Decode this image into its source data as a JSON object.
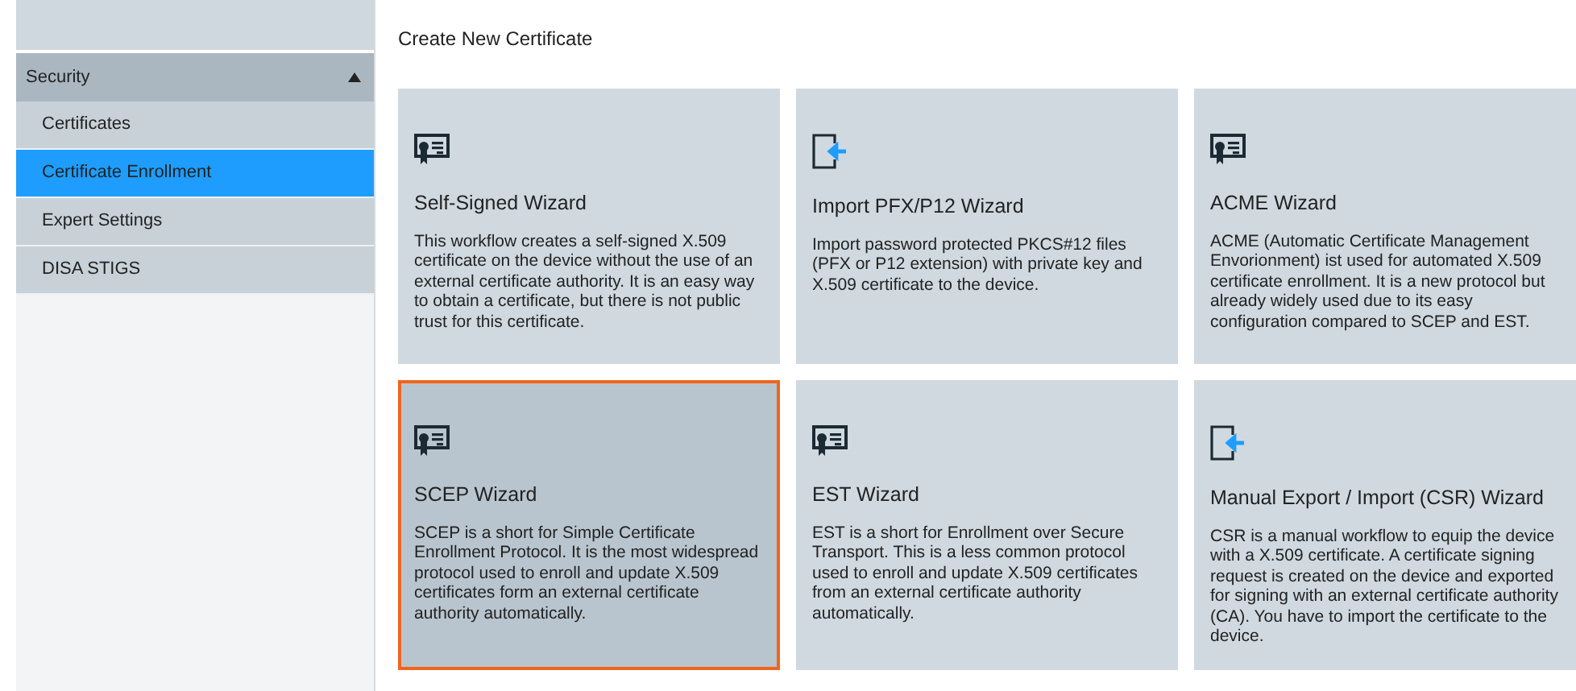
{
  "sidebar": {
    "section": {
      "label": "Security",
      "expanded": true
    },
    "items": [
      {
        "label": "Certificates",
        "selected": false
      },
      {
        "label": "Certificate Enrollment",
        "selected": true
      },
      {
        "label": "Expert Settings",
        "selected": false
      },
      {
        "label": "DISA STIGS",
        "selected": false
      }
    ]
  },
  "page_title": "Create New Certificate",
  "cards": [
    {
      "kind": "certificate",
      "title": "Self-Signed Wizard",
      "description": "This workflow creates a self-signed X.509 certificate on the device without the use of an external certificate authority. It is an easy way to obtain a certificate, but there is not public trust for this certificate.",
      "selected": false
    },
    {
      "kind": "import",
      "title": "Import PFX/P12 Wizard",
      "description": "Import password protected PKCS#12 files (PFX or P12 extension) with private key and X.509 certificate to the device.",
      "selected": false
    },
    {
      "kind": "certificate",
      "title": "ACME Wizard",
      "description": "ACME (Automatic Certificate Management Envorionment) ist used for automated X.509 certificate enrollment. It is a new protocol but already widely used due to its easy configuration compared to SCEP and EST.",
      "selected": false
    },
    {
      "kind": "certificate",
      "title": "SCEP Wizard",
      "description": "SCEP is a short for Simple Certificate Enrollment Protocol. It is the most widespread protocol used to enroll and update X.509 certificates form an external certificate authority automatically.",
      "selected": true
    },
    {
      "kind": "certificate",
      "title": "EST Wizard",
      "description": "EST is a short for Enrollment over Secure Transport. This is a less common protocol used to enroll and update X.509 certificates from an external certificate authority automatically.",
      "selected": false
    },
    {
      "kind": "import",
      "title": "Manual Export / Import (CSR) Wizard",
      "description": "CSR is a manual workflow to equip the device with a X.509 certificate. A certificate signing request is created on the device and exported for signing with an external certificate authority (CA). You have to import the certificate to the device.",
      "selected": false
    }
  ]
}
